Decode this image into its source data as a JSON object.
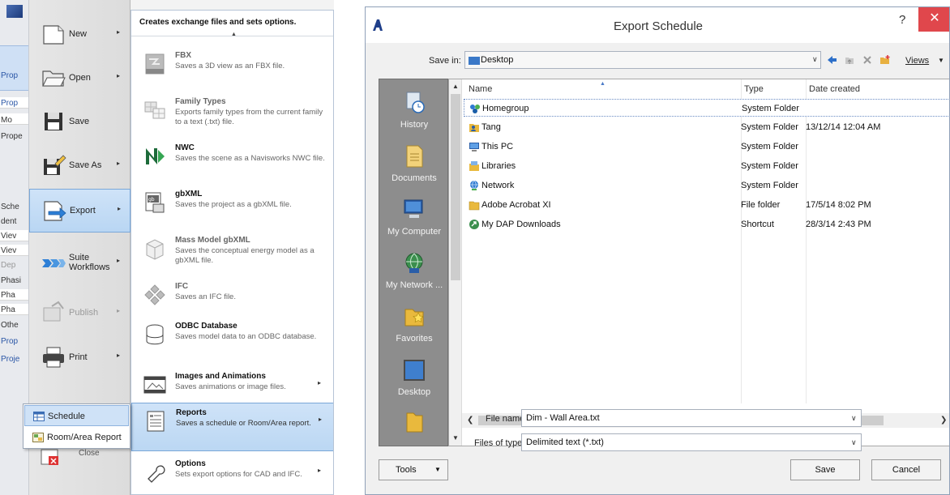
{
  "revit": {
    "strip": {
      "props_active": "Prop",
      "labels": [
        "Prop",
        "Mo",
        "Prope",
        "Sche",
        "dent",
        "Viev",
        "Viev",
        "Dep",
        "Phasi",
        "Pha",
        "Pha",
        "Othe",
        "Prop",
        "Proje"
      ]
    },
    "menu": [
      {
        "label": "New",
        "icon": "new-document-icon",
        "arrow": "▸",
        "state": "normal"
      },
      {
        "label": "Open",
        "icon": "open-folder-icon",
        "arrow": "▸",
        "state": "normal"
      },
      {
        "label": "Save",
        "icon": "save-floppy-icon",
        "arrow": "",
        "state": "normal"
      },
      {
        "label": "Save As",
        "icon": "save-as-icon",
        "arrow": "▸",
        "state": "normal"
      },
      {
        "label": "Export",
        "icon": "export-icon",
        "arrow": "▸",
        "state": "active"
      },
      {
        "label": "Suite Workflows",
        "icon": "suite-workflows-icon",
        "arrow": "▸",
        "state": "normal"
      },
      {
        "label": "Publish",
        "icon": "publish-icon",
        "arrow": "▸",
        "state": "disabled"
      },
      {
        "label": "Print",
        "icon": "printer-icon",
        "arrow": "▸",
        "state": "normal"
      }
    ],
    "close_label": "Close",
    "submenu": {
      "header": "Creates exchange files and sets options.",
      "items": [
        {
          "title": "FBX",
          "desc": "Saves a 3D view as an FBX file.",
          "icon": "fbx-icon",
          "state": "disabled",
          "arrow": ""
        },
        {
          "title": "Family Types",
          "desc": "Exports family types from the current family to a text (.txt) file.",
          "icon": "family-types-icon",
          "state": "disabled",
          "arrow": ""
        },
        {
          "title": "NWC",
          "desc": "Saves the scene as a Navisworks NWC file.",
          "icon": "navisworks-nwc-icon",
          "state": "normal",
          "arrow": ""
        },
        {
          "title": "gbXML",
          "desc": "Saves the project as a gbXML file.",
          "icon": "gbxml-icon",
          "state": "normal",
          "arrow": ""
        },
        {
          "title": "Mass Model gbXML",
          "desc": "Saves the conceptual energy model as a gbXML file.",
          "icon": "mass-model-gbxml-icon",
          "state": "disabled",
          "arrow": ""
        },
        {
          "title": "IFC",
          "desc": "Saves an IFC file.",
          "icon": "ifc-icon",
          "state": "disabled",
          "arrow": ""
        },
        {
          "title": "ODBC Database",
          "desc": "Saves model data to an ODBC database.",
          "icon": "odbc-database-icon",
          "state": "normal",
          "arrow": ""
        },
        {
          "title": "Images and Animations",
          "desc": "Saves animations or image files.",
          "icon": "images-animations-icon",
          "state": "normal",
          "arrow": "▸"
        },
        {
          "title": "Reports",
          "desc": "Saves a schedule or Room/Area report.",
          "icon": "reports-icon",
          "state": "active",
          "arrow": "▸"
        },
        {
          "title": "Options",
          "desc": "Sets export options for CAD and IFC.",
          "icon": "options-icon",
          "state": "normal",
          "arrow": "▸"
        }
      ]
    },
    "flyout": [
      {
        "label": "Schedule",
        "icon": "schedule-icon",
        "state": "active"
      },
      {
        "label": "Room/Area Report",
        "icon": "room-area-report-icon",
        "state": "normal"
      }
    ]
  },
  "dialog": {
    "title": "Export Schedule",
    "help": "?",
    "close": "✕",
    "save_in_label": "Save in:",
    "save_in_value": "Desktop",
    "views_label": "Views",
    "places": [
      {
        "label": "History",
        "icon": "history-icon"
      },
      {
        "label": "Documents",
        "icon": "documents-icon"
      },
      {
        "label": "My Computer",
        "icon": "my-computer-icon"
      },
      {
        "label": "My Network ...",
        "icon": "my-network-icon"
      },
      {
        "label": "Favorites",
        "icon": "favorites-icon"
      },
      {
        "label": "Desktop",
        "icon": "desktop-icon"
      }
    ],
    "columns": {
      "name": "Name",
      "type": "Type",
      "date": "Date created"
    },
    "rows": [
      {
        "name": "Homegroup",
        "type": "System Folder",
        "date": "",
        "icon": "homegroup-icon"
      },
      {
        "name": "Tang",
        "type": "System Folder",
        "date": "13/12/14 12:04 AM",
        "icon": "user-folder-icon"
      },
      {
        "name": "This PC",
        "type": "System Folder",
        "date": "",
        "icon": "this-pc-icon"
      },
      {
        "name": "Libraries",
        "type": "System Folder",
        "date": "",
        "icon": "libraries-icon"
      },
      {
        "name": "Network",
        "type": "System Folder",
        "date": "",
        "icon": "network-icon"
      },
      {
        "name": "Adobe Acrobat XI",
        "type": "File folder",
        "date": "17/5/14 8:02 PM",
        "icon": "folder-icon"
      },
      {
        "name": "My DAP Downloads",
        "type": "Shortcut",
        "date": "28/3/14 2:43 PM",
        "icon": "shortcut-icon"
      }
    ],
    "file_name_label": "File name:",
    "file_name_value": "Dim - Wall Area.txt",
    "file_type_label": "Files of type:",
    "file_type_value": "Delimited text  (*.txt)",
    "tools_label": "Tools",
    "save_label": "Save",
    "cancel_label": "Cancel"
  }
}
